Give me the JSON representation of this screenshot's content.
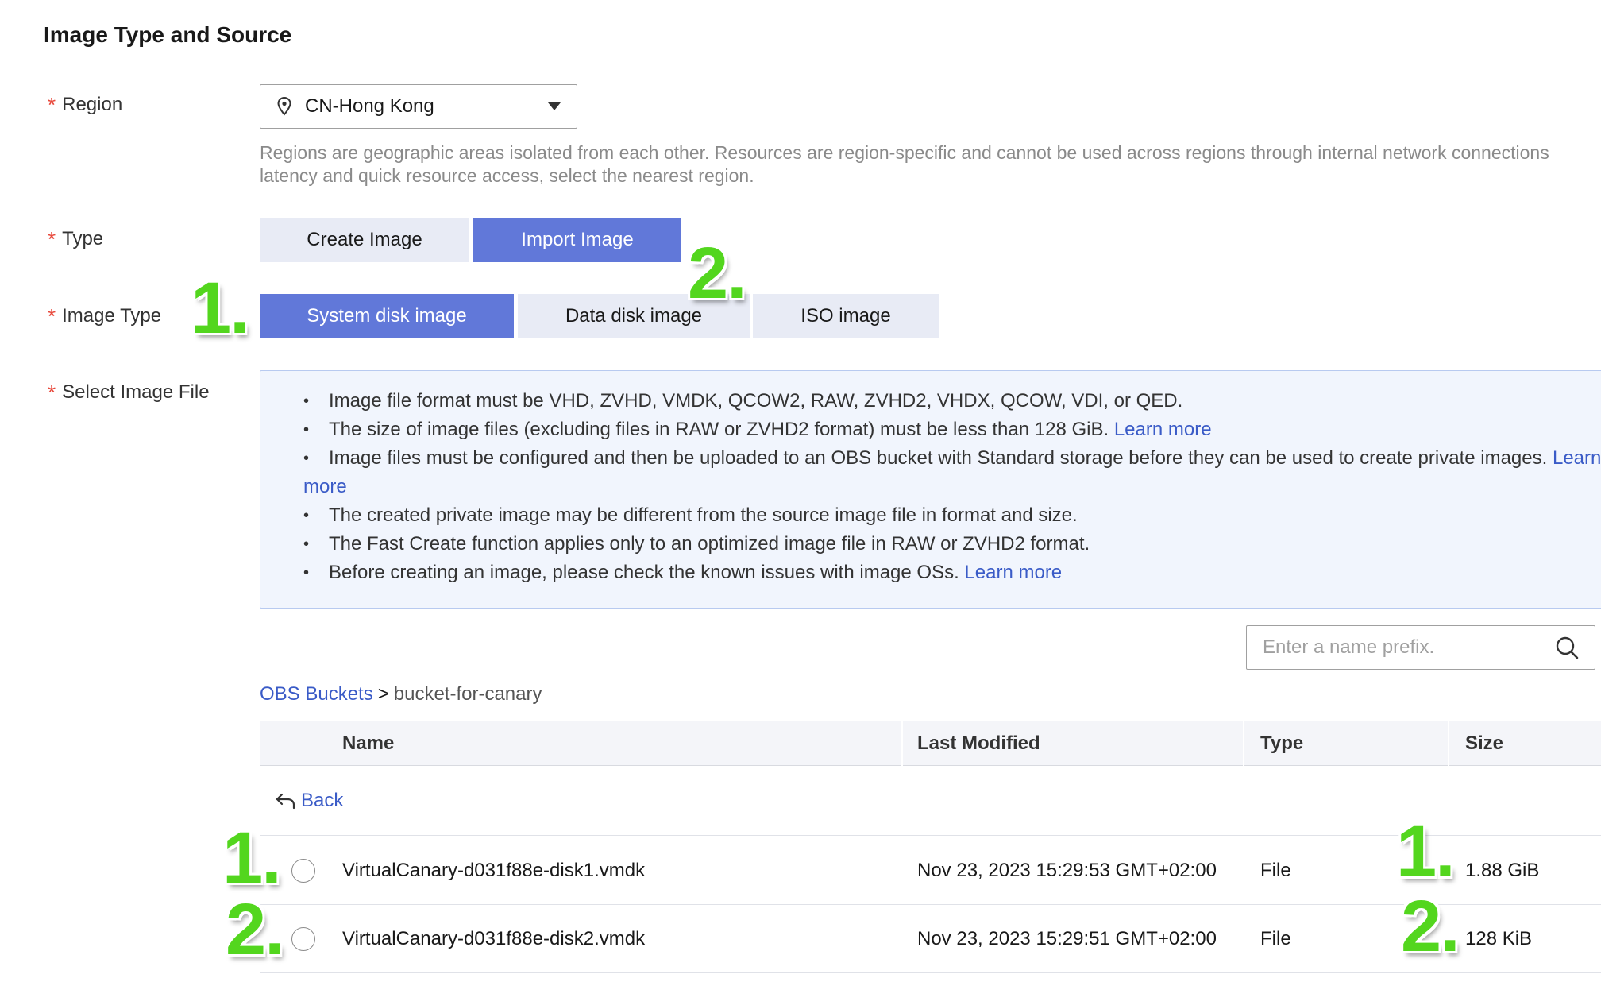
{
  "section": {
    "title": "Image Type and Source"
  },
  "region": {
    "label": "Region",
    "value": "CN-Hong Kong",
    "hint_line1": "Regions are geographic areas isolated from each other. Resources are region-specific and cannot be used across regions through internal network connections",
    "hint_line2": "latency and quick resource access, select the nearest region."
  },
  "type": {
    "label": "Type",
    "options": [
      {
        "label": "Create Image",
        "selected": false
      },
      {
        "label": "Import Image",
        "selected": true
      }
    ]
  },
  "image_type": {
    "label": "Image Type",
    "options": [
      {
        "label": "System disk image",
        "selected": true
      },
      {
        "label": "Data disk image",
        "selected": false
      },
      {
        "label": "ISO image",
        "selected": false
      }
    ]
  },
  "select_file": {
    "label": "Select Image File",
    "notes": [
      {
        "text": "Image file format must be VHD, ZVHD, VMDK, QCOW2, RAW, ZVHD2, VHDX, QCOW, VDI, or QED.",
        "link": ""
      },
      {
        "text": "The size of image files (excluding files in RAW or ZVHD2 format) must be less than 128 GiB.",
        "link": "Learn more"
      },
      {
        "text": "Image files must be configured and then be uploaded to an OBS bucket with Standard storage before they can be used to create private images.",
        "link": "Learn",
        "link_cont": "more"
      },
      {
        "text": "The created private image may be different from the source image file in format and size.",
        "link": ""
      },
      {
        "text": "The Fast Create function applies only to an optimized image file in RAW or ZVHD2 format.",
        "link": ""
      },
      {
        "text": "Before creating an image, please check the known issues with image OSs.",
        "link": "Learn more"
      }
    ]
  },
  "search": {
    "placeholder": "Enter a name prefix."
  },
  "breadcrumb": {
    "root": "OBS Buckets",
    "separator": ">",
    "current": "bucket-for-canary"
  },
  "table": {
    "headers": [
      "Name",
      "Last Modified",
      "Type",
      "Size"
    ],
    "back_label": "Back",
    "rows": [
      {
        "name": "VirtualCanary-d031f88e-disk1.vmdk",
        "modified": "Nov 23, 2023 15:29:53 GMT+02:00",
        "type": "File",
        "size": "1.88 GiB"
      },
      {
        "name": "VirtualCanary-d031f88e-disk2.vmdk",
        "modified": "Nov 23, 2023 15:29:51 GMT+02:00",
        "type": "File",
        "size": "128 KiB"
      }
    ]
  },
  "annotations": [
    "1.",
    "2.",
    "1.",
    "2.",
    "1.",
    "2."
  ],
  "colors": {
    "accent": "#6178d9",
    "link": "#3a5bc7",
    "annotation": "#53d61e",
    "required": "#e8483b"
  }
}
